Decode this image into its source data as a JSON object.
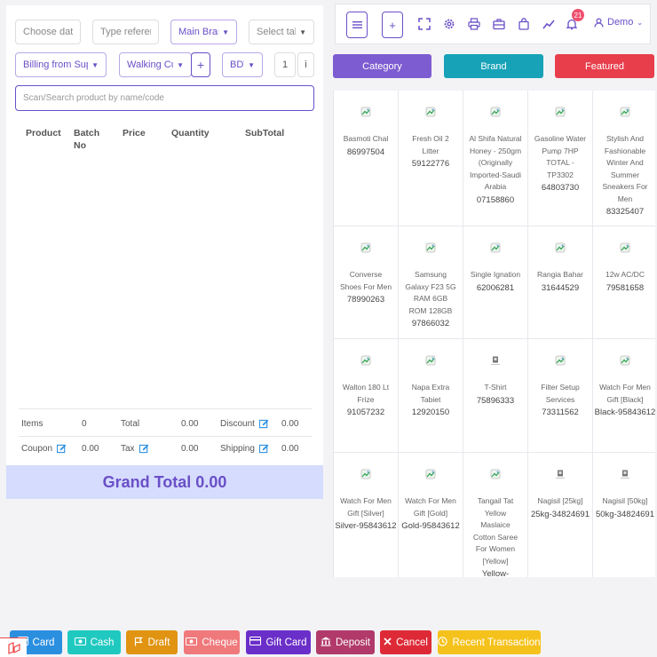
{
  "filters": {
    "date_placeholder": "Choose date",
    "reference_placeholder": "Type reference",
    "branch": "Main Branch",
    "table": "Select table",
    "billing": "Billing from Supplier",
    "customer": "Walking Customer",
    "currency": "BDT",
    "qty": "1",
    "qty_suffix": "i",
    "plus": "+"
  },
  "search": {
    "placeholder": "Scan/Search product by name/code"
  },
  "table": {
    "headers": {
      "product": "Product",
      "batch": "Batch",
      "batch2": "No",
      "price": "Price",
      "quantity": "Quantity",
      "subtotal": "SubTotal"
    }
  },
  "summary": {
    "items_label": "Items",
    "items_value": "0",
    "total_label": "Total",
    "total_value": "0.00",
    "discount_label": "Discount",
    "discount_value": "0.00",
    "coupon_label": "Coupon",
    "coupon_value": "0.00",
    "tax_label": "Tax",
    "tax_value": "0.00",
    "shipping_label": "Shipping",
    "shipping_value": "0.00"
  },
  "grand_total": "Grand Total 0.00",
  "topbar": {
    "notifications": "21",
    "user": "Demo"
  },
  "tabs": [
    {
      "label": "Category",
      "color": "#7d5bd0"
    },
    {
      "label": "Brand",
      "color": "#17a2b8"
    },
    {
      "label": "Featured",
      "color": "#e83e4c"
    }
  ],
  "products": [
    {
      "name": "Basmoti Chal",
      "code": "86997504",
      "icon": "broken-image-icon"
    },
    {
      "name": "Fresh Oil 2 Litter",
      "code": "59122776",
      "icon": "broken-image-icon"
    },
    {
      "name": "Al Shifa Natural Honey - 250gm (Originally Imported-Saudi Arabia",
      "code": "07158860",
      "icon": "broken-image-icon"
    },
    {
      "name": "Gasoline Water Pump 7HP TOTAL - TP3302",
      "code": "64803730",
      "icon": "broken-image-icon"
    },
    {
      "name": "Stylish And Fashionable Winter And Summer Sneakers For Men",
      "code": "83325407",
      "icon": "broken-image-icon"
    },
    {
      "name": "Converse Shoes For Men",
      "code": "78990263",
      "icon": "broken-image-icon"
    },
    {
      "name": "Samsung Galaxy F23 5G RAM 6GB ROM 128GB",
      "code": "97866032",
      "icon": "broken-image-icon"
    },
    {
      "name": "Single Ignation",
      "code": "62006281",
      "icon": "broken-image-icon"
    },
    {
      "name": "Rangia Bahar",
      "code": "31644529",
      "icon": "broken-image-icon"
    },
    {
      "name": "12w AC/DC",
      "code": "79581658",
      "icon": "broken-image-icon"
    },
    {
      "name": "Walton 180 Lt Frize",
      "code": "91057232",
      "icon": "broken-image-icon"
    },
    {
      "name": "Napa Extra Tabiet",
      "code": "12920150",
      "icon": "broken-image-icon"
    },
    {
      "name": "T-Shirt",
      "code": "75896333",
      "icon": "no-image-icon"
    },
    {
      "name": "Filter Setup Services",
      "code": "73311562",
      "icon": "broken-image-icon"
    },
    {
      "name": "Watch For Men Gift [Black]",
      "code": "Black-95843612",
      "icon": "broken-image-icon"
    },
    {
      "name": "Watch For Men Gift [Silver]",
      "code": "Silver-95843612",
      "icon": "broken-image-icon"
    },
    {
      "name": "Watch For Men Gift [Gold]",
      "code": "Gold-95843612",
      "icon": "broken-image-icon"
    },
    {
      "name": "Tangail Tat Yellow Maslaice Cotton Saree For Women [Yellow]",
      "code": "Yellow-",
      "icon": "broken-image-icon"
    },
    {
      "name": "Nagisil [25kg]",
      "code": "25kg-34824691",
      "icon": "no-image-icon"
    },
    {
      "name": "Nagisil [50kg]",
      "code": "50kg-34824691",
      "icon": "no-image-icon"
    }
  ],
  "actions": [
    {
      "label": "Card",
      "color": "#2b8fe0",
      "icon": "card-icon"
    },
    {
      "label": "Cash",
      "color": "#20c9c0",
      "icon": "cash-icon"
    },
    {
      "label": "Draft",
      "color": "#e09412",
      "icon": "flag-icon"
    },
    {
      "label": "Cheque",
      "color": "#f0797c",
      "icon": "cheque-icon"
    },
    {
      "label": "Gift Card",
      "color": "#6b2fc9",
      "icon": "gift-card-icon"
    },
    {
      "label": "Deposit",
      "color": "#b13a6a",
      "icon": "bank-icon"
    },
    {
      "label": "Cancel",
      "color": "#de2a37",
      "icon": "close-icon"
    },
    {
      "label": "Recent Transaction",
      "color": "#f5c21b",
      "icon": "clock-icon"
    }
  ]
}
